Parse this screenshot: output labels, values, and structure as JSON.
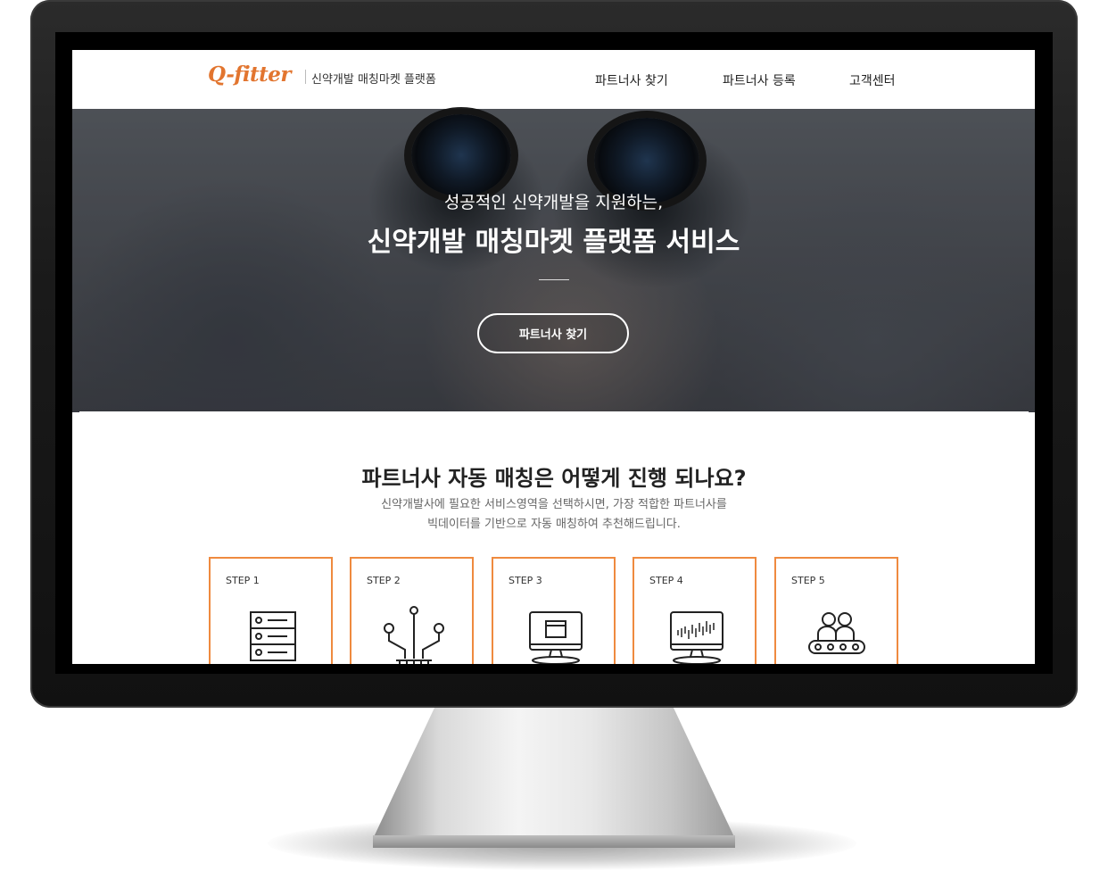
{
  "brand": {
    "logo": "Q-fitter",
    "tagline": "신약개발 매칭마켓 플랫폼",
    "accent": "#ef8a3f"
  },
  "nav": {
    "items": [
      {
        "label": "파트너사 찾기"
      },
      {
        "label": "파트너사 등록"
      },
      {
        "label": "고객센터"
      }
    ]
  },
  "hero": {
    "subtitle": "성공적인 신약개발을 지원하는,",
    "title": "신약개발 매칭마켓 플랫폼 서비스",
    "button": "파트너사 찾기"
  },
  "section": {
    "title": "파트너사 자동 매칭은 어떻게 진행 되나요?",
    "desc_line1": "신약개발사에 필요한 서비스영역을 선택하시면, 가장 적합한 파트너사를",
    "desc_line2": "빅데이터를 기반으로 자동 매칭하여 추천해드립니다."
  },
  "steps": [
    {
      "label": "STEP 1",
      "icon": "server-icon"
    },
    {
      "label": "STEP 2",
      "icon": "circuit-icon"
    },
    {
      "label": "STEP 3",
      "icon": "monitor-window-icon"
    },
    {
      "label": "STEP 4",
      "icon": "monitor-chart-icon"
    },
    {
      "label": "STEP 5",
      "icon": "people-conveyor-icon"
    }
  ]
}
